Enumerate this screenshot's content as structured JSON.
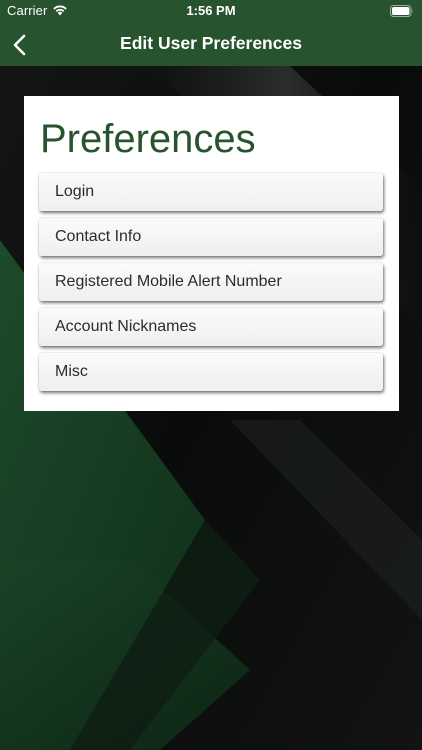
{
  "status_bar": {
    "carrier": "Carrier",
    "time": "1:56 PM"
  },
  "nav": {
    "title": "Edit User Preferences",
    "back_icon": "chevron-left-icon"
  },
  "card": {
    "title": "Preferences",
    "items": [
      {
        "label": "Login"
      },
      {
        "label": "Contact Info"
      },
      {
        "label": "Registered Mobile Alert Number"
      },
      {
        "label": "Account Nicknames"
      },
      {
        "label": "Misc"
      }
    ]
  },
  "colors": {
    "brand_green": "#28532f",
    "title_green": "#27532e",
    "background": "#0b0c0c"
  }
}
